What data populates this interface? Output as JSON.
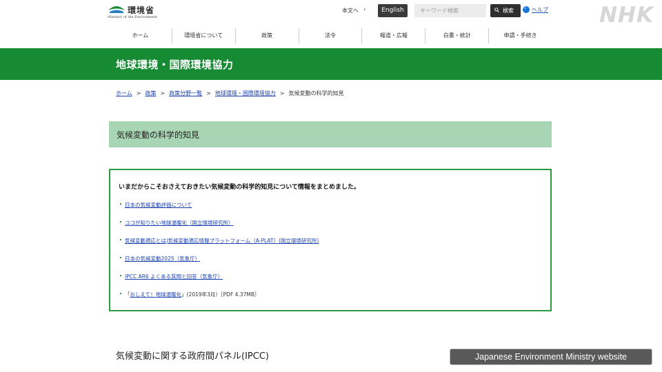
{
  "header": {
    "logo_jp": "環境省",
    "logo_en": "Ministry of the Environment",
    "text_link": "本文へ",
    "english_button": "English",
    "search_placeholder": "キーワード検索",
    "search_button": "検索",
    "help_link": "ヘルプ",
    "broadcaster_mark": "NHK"
  },
  "nav": {
    "items": [
      "ホーム",
      "環境省について",
      "政策",
      "法令",
      "報道・広報",
      "白書・統計",
      "申請・手続き"
    ]
  },
  "banner": {
    "title": "地球環境・国際環境協力"
  },
  "breadcrumb": {
    "items": [
      "ホーム",
      "政策",
      "政策分野一覧",
      "地球環境・国際環境協力"
    ],
    "current": "気候変動の科学的知見",
    "separator": ">"
  },
  "section": {
    "title": "気候変動の科学的知見"
  },
  "infobox": {
    "intro": "いまだからこそおさえておきたい気候変動の科学的知見について情報をまとめました。",
    "links": [
      "日本の気候変動評価について",
      "ココが知りたい地球温暖化（国立環境研究所）",
      "気候変動適応とは|気候変動適応情報プラットフォーム（A-PLAT）(国立環境研究所)",
      "日本の気候変動2025（気象庁）",
      "IPCC AR6 よくある質問と回答（気象庁）"
    ],
    "last_item": {
      "prefix": "「",
      "link": "おしえて！地球温暖化",
      "suffix": "」(2019年3月）［PDF 4.37MB］"
    }
  },
  "subheading": "気候変動に関する政府間パネル(IPCC)",
  "caption": "Japanese Environment Ministry website",
  "colors": {
    "green": "#178a34",
    "light_green": "#a8d5b3",
    "border_green": "#29993f",
    "link": "#1a3fb0"
  }
}
